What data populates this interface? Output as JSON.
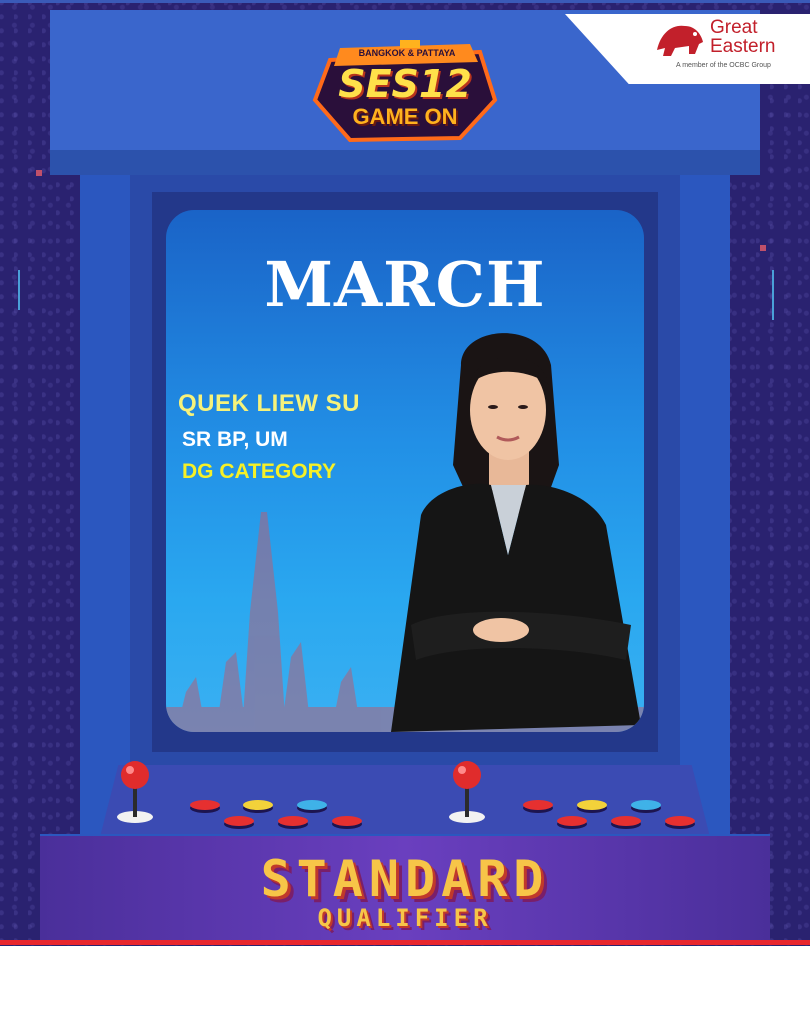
{
  "event_logo": {
    "top_text": "BANGKOK & PATTAYA",
    "main_text": "SES12",
    "sub_text": "GAME ON"
  },
  "brand": {
    "name_line1": "Great",
    "name_line2": "Eastern",
    "tagline": "A member of the OCBC Group"
  },
  "screen": {
    "headline": "MARCH",
    "name": "QUEK LIEW SU",
    "role": "SR BP, UM",
    "category": "DG CATEGORY"
  },
  "banner": {
    "title": "STANDARD",
    "subtitle": "QUALIFIER"
  },
  "colors": {
    "name_yellow": "#f6f27a",
    "category_yellow": "#f6f027",
    "brand_red": "#c2202b",
    "banner_gold": "#f7c548"
  }
}
